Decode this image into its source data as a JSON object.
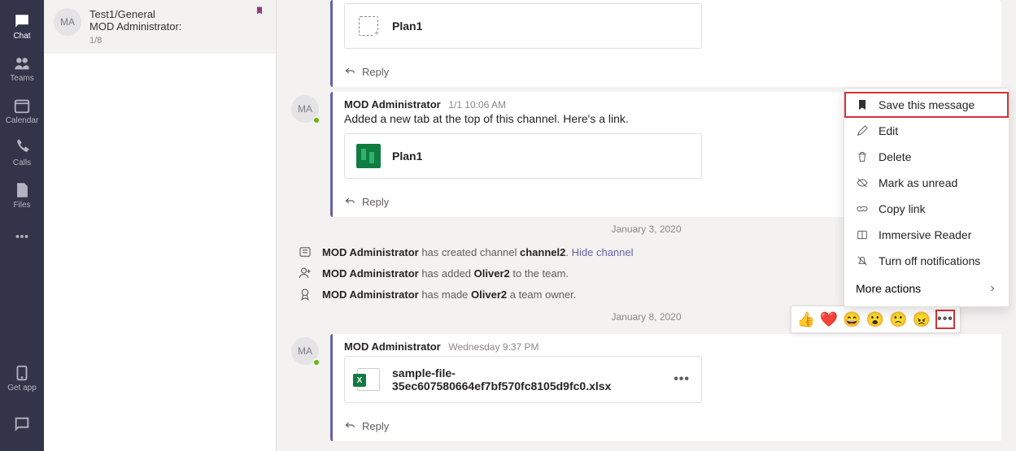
{
  "rail": {
    "chat": "Chat",
    "teams": "Teams",
    "calendar": "Calendar",
    "calls": "Calls",
    "files": "Files",
    "getapp": "Get app"
  },
  "chatlist": {
    "item": {
      "avatar": "MA",
      "title": "Test1/General",
      "snippet": "MOD Administrator:",
      "meta": "1/8"
    }
  },
  "messages": {
    "m0": {
      "attachment_title": "Plan1",
      "reply": "Reply"
    },
    "m1": {
      "avatar": "MA",
      "author": "MOD Administrator",
      "time": "1/1 10:06 AM",
      "text": "Added a new tab at the top of this channel. Here's a link.",
      "attachment_title": "Plan1",
      "reply": "Reply"
    },
    "date1": "January 3, 2020",
    "sys1": {
      "who": "MOD Administrator",
      "mid": " has created channel ",
      "obj": "channel2",
      "tail": ". ",
      "link": "Hide channel"
    },
    "sys2": {
      "who": "MOD Administrator",
      "mid": " has added ",
      "obj": "Oliver2",
      "tail": " to the team."
    },
    "sys3": {
      "who": "MOD Administrator",
      "mid": " has made ",
      "obj": "Oliver2",
      "tail": " a team owner."
    },
    "date2": "January 8, 2020",
    "m2": {
      "avatar": "MA",
      "author": "MOD Administrator",
      "time": "Wednesday 9:37 PM",
      "attachment_title": "sample-file-35ec607580664ef7bf570fc8105d9fc0.xlsx",
      "reply": "Reply"
    }
  },
  "reactions": {
    "r0": "👍",
    "r1": "❤️",
    "r2": "😄",
    "r3": "😮",
    "r4": "🙁",
    "r5": "😠",
    "more": "•••"
  },
  "menu": {
    "save": "Save this message",
    "edit": "Edit",
    "delete": "Delete",
    "unread": "Mark as unread",
    "copy": "Copy link",
    "reader": "Immersive Reader",
    "notif": "Turn off notifications",
    "more": "More actions"
  }
}
